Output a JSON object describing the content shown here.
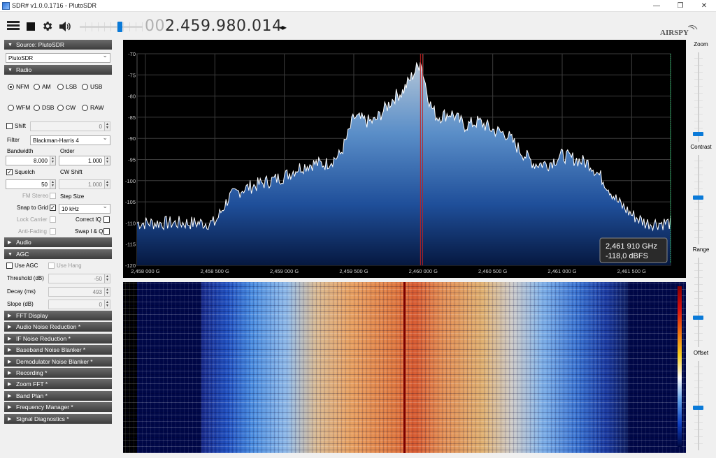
{
  "window": {
    "title": "SDR# v1.0.0.1716 - PlutoSDR",
    "controls": [
      "—",
      "❐",
      "✕"
    ]
  },
  "toolbar": {
    "frequency_dim": "00",
    "frequency_main": "2.459.980.014",
    "tune_arrows": "◂▸",
    "logo": "AIRSPY",
    "icons": [
      "menu-icon",
      "stop-icon",
      "gear-icon",
      "speaker-icon"
    ]
  },
  "source": {
    "header": "Source: PlutoSDR",
    "device": "PlutoSDR"
  },
  "radio": {
    "header": "Radio",
    "modes": [
      "NFM",
      "AM",
      "LSB",
      "USB",
      "WFM",
      "DSB",
      "CW",
      "RAW"
    ],
    "selected_mode": "NFM",
    "shift_label": "Shift",
    "shift_value": "0",
    "filter_label": "Filter",
    "filter_value": "Blackman-Harris 4",
    "bandwidth_label": "Bandwidth",
    "bandwidth_value": "8.000",
    "order_label": "Order",
    "order_value": "1.000",
    "squelch_label": "Squelch",
    "squelch_value": "50",
    "cw_shift_label": "CW Shift",
    "cw_shift_value": "1.000",
    "fm_stereo_label": "FM Stereo",
    "step_size_label": "Step Size",
    "snap_to_grid_label": "Snap to Grid",
    "step_size_value": "10 kHz",
    "lock_carrier_label": "Lock Carrier",
    "correct_iq_label": "Correct IQ",
    "anti_fading_label": "Anti-Fading",
    "swap_iq_label": "Swap I & Q"
  },
  "audio": {
    "header": "Audio"
  },
  "agc": {
    "header": "AGC",
    "use_agc_label": "Use AGC",
    "use_hang_label": "Use Hang",
    "threshold_label": "Threshold (dB)",
    "threshold_value": "-50",
    "decay_label": "Decay (ms)",
    "decay_value": "493",
    "slope_label": "Slope (dB)",
    "slope_value": "0"
  },
  "plugins": [
    "FFT Display",
    "Audio Noise Reduction *",
    "IF Noise Reduction *",
    "Baseband Noise Blanker *",
    "Demodulator Noise Blanker *",
    "Recording *",
    "Zoom FFT *",
    "Band Plan *",
    "Frequency Manager *",
    "Signal Diagnostics *"
  ],
  "right_panel": {
    "zoom_label": "Zoom",
    "contrast_label": "Contrast",
    "range_label": "Range",
    "offset_label": "Offset"
  },
  "cursor_readout": {
    "frequency": "2,461 910 GHz",
    "level": "-118,0 dBFS"
  },
  "colors": {
    "accent": "#0a7ad8",
    "section_header": "#4a4a4a",
    "spectrum_bg": "#000000",
    "trace": "#ffffff",
    "fill_top": "#a9bfd6",
    "fill_bottom": "#0a2a6a",
    "cursor_line": "#c02020"
  },
  "chart_data": {
    "type": "area",
    "title": "",
    "xlabel": "",
    "ylabel": "",
    "ylim": [
      -120,
      -70
    ],
    "y_ticks": [
      -70,
      -75,
      -80,
      -85,
      -90,
      -95,
      -100,
      -105,
      -110,
      -115,
      -120
    ],
    "x_ticks": [
      "2,458 000 G",
      "2,458 500 G",
      "2,459 000 G",
      "2,459 500 G",
      "2,460 000 G",
      "2,460 500 G",
      "2,461 000 G",
      "2,461 500 G"
    ],
    "x_tick_values_ghz": [
      2.458,
      2.4585,
      2.459,
      2.4595,
      2.46,
      2.4605,
      2.461,
      2.4615
    ],
    "xlim_ghz": [
      2.45794,
      2.46178
    ],
    "grid": true,
    "center_ghz": 2.45998,
    "series": [
      {
        "x": [
          2.45794,
          2.4582,
          2.4585,
          2.4586,
          2.4587,
          2.4589,
          2.459,
          2.4591,
          2.4592,
          2.4593,
          2.4594,
          2.45945,
          2.4595,
          2.4596,
          2.45965,
          2.4597,
          2.4598,
          2.45985,
          2.45998,
          2.46005,
          2.4601,
          2.4602,
          2.4603,
          2.4604,
          2.4605,
          2.4606,
          2.4607,
          2.4608,
          2.4609,
          2.461,
          2.4611,
          2.4612,
          2.4613,
          2.4614,
          2.4615,
          2.4616,
          2.4617,
          2.46178
        ],
        "values": [
          -110,
          -110,
          -110,
          -104,
          -102,
          -100,
          -99,
          -97,
          -96,
          -96,
          -94,
          -90,
          -85,
          -86,
          -86,
          -84,
          -80,
          -79,
          -72,
          -82,
          -85,
          -84,
          -87,
          -86,
          -88,
          -89,
          -93,
          -96,
          -96,
          -94,
          -95,
          -96,
          -100,
          -105,
          -108,
          -110,
          -110,
          -110
        ]
      }
    ]
  }
}
